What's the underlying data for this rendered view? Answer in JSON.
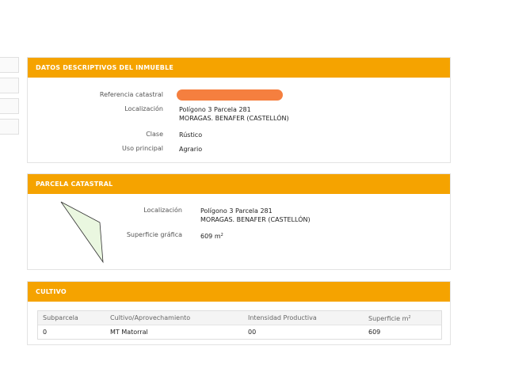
{
  "panels": {
    "datos": {
      "title": "DATOS DESCRIPTIVOS DEL INMUEBLE",
      "ref_label": "Referencia catastral",
      "loc_label": "Localización",
      "loc_line1": "Polígono 3 Parcela 281",
      "loc_line2": "MORAGAS. BENAFER (CASTELLÓN)",
      "clase_label": "Clase",
      "clase_value": "Rústico",
      "uso_label": "Uso principal",
      "uso_value": "Agrario"
    },
    "parcela": {
      "title": "PARCELA CATASTRAL",
      "loc_label": "Localización",
      "loc_line1": "Polígono 3 Parcela 281",
      "loc_line2": "MORAGAS. BENAFER (CASTELLÓN)",
      "sup_label": "Superficie gráfica",
      "sup_value": "609 m",
      "sup_exp": "2"
    },
    "cultivo": {
      "title": "CULTIVO",
      "headers": [
        "Subparcela",
        "Cultivo/Aprovechamiento",
        "Intensidad Productiva",
        "Superficie m"
      ],
      "header_exp": "2",
      "row": [
        "0",
        "MT Matorral",
        "00",
        "609"
      ]
    }
  },
  "colors": {
    "accent": "#f5a300",
    "redaction": "#f57f3f",
    "parcel_fill": "#eaf7e0"
  }
}
